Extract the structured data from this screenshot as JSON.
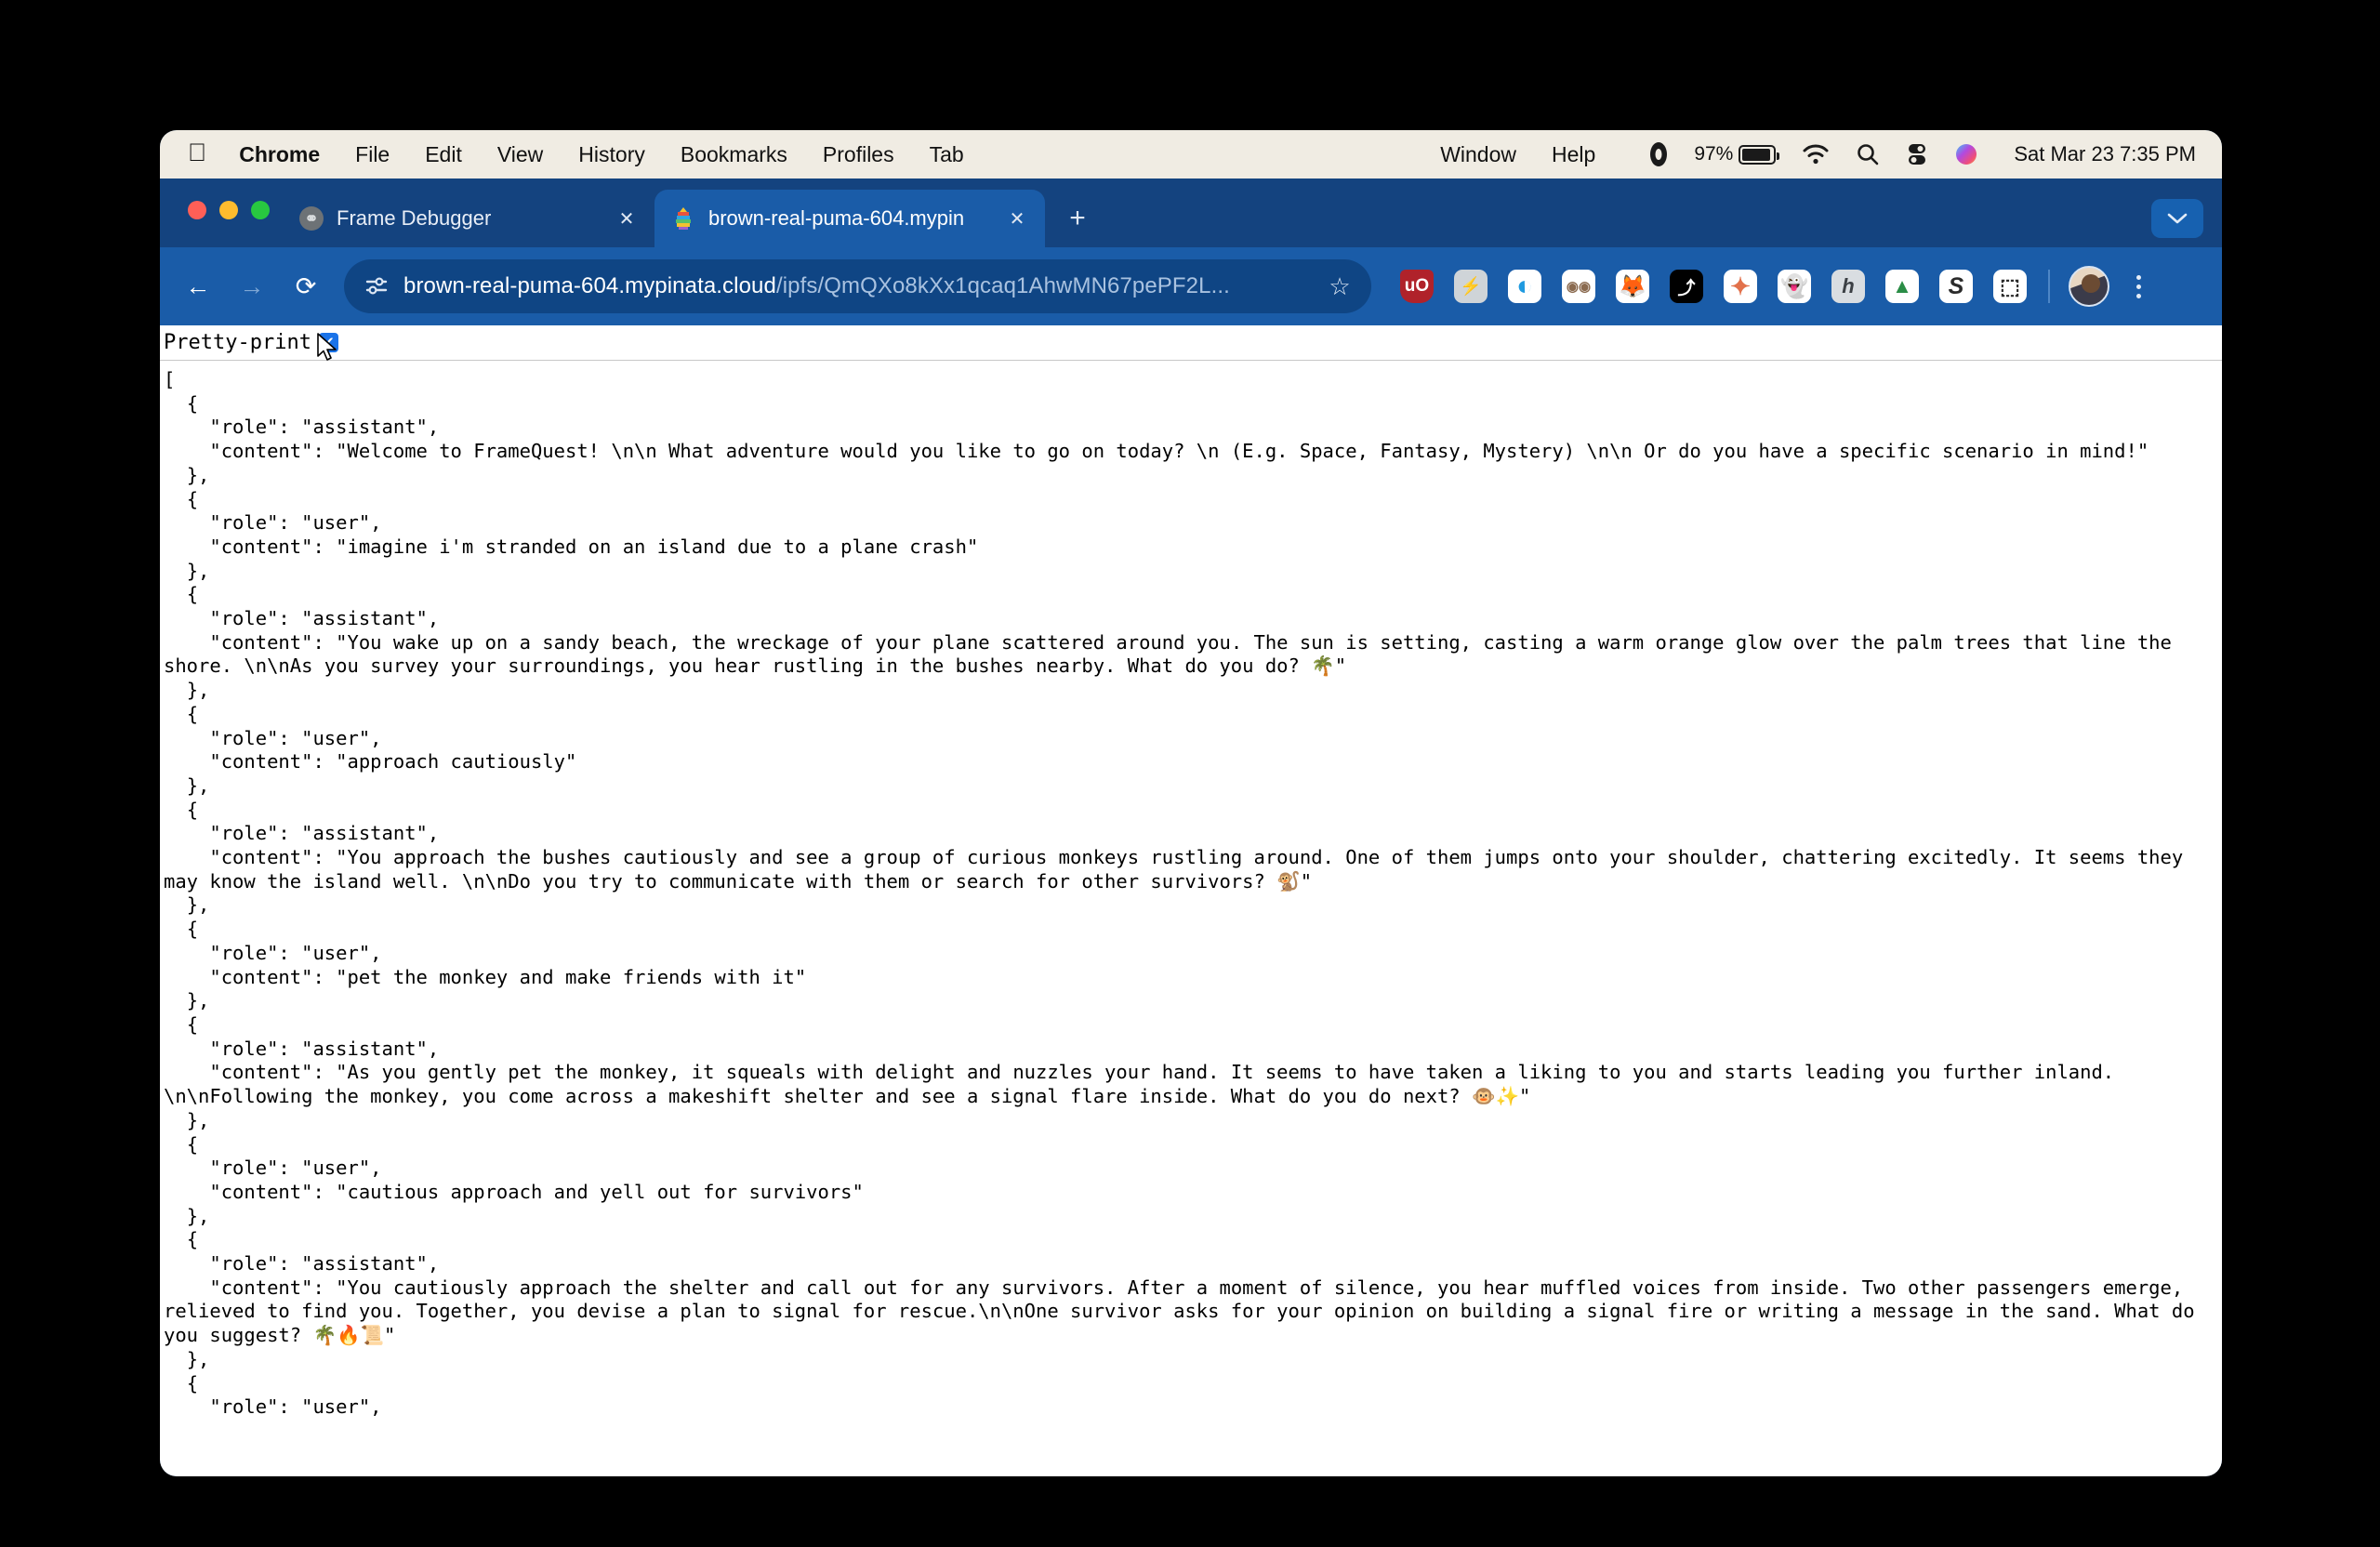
{
  "menubar": {
    "apple_icon": "apple-logo",
    "items": [
      "Chrome",
      "File",
      "Edit",
      "View",
      "History",
      "Bookmarks",
      "Profiles",
      "Tab"
    ],
    "right_items": [
      "Window",
      "Help"
    ],
    "status": {
      "recording_icon": "record-indicator-icon",
      "battery_percent": "97%",
      "battery_icon": "battery-icon",
      "wifi_icon": "wifi-icon",
      "search_icon": "spotlight-search-icon",
      "control_center_icon": "control-center-icon",
      "siri_icon": "siri-icon",
      "clock": "Sat Mar 23  7:35 PM"
    }
  },
  "tabs": [
    {
      "title": "Frame Debugger",
      "favicon": "frame-debugger-favicon",
      "active": false,
      "close": "✕"
    },
    {
      "title": "brown-real-puma-604.mypin",
      "favicon": "pinata-favicon",
      "active": true,
      "close": "✕"
    }
  ],
  "tabstrip": {
    "new_tab_label": "+",
    "tab_list_chevron": "⌄"
  },
  "toolbar": {
    "back_label": "←",
    "forward_label": "→",
    "reload_label": "⟳",
    "site_info_icon": "site-settings-icon",
    "url_domain": "brown-real-puma-604.mypinata.cloud",
    "url_path": "/ipfs/QmQXo8kXx1qcaq1AhwMN67pePF2L...",
    "bookmark_label": "☆",
    "extensions": [
      {
        "name": "ublock-origin-extension",
        "glyph": "uO",
        "bg": "#b0222a",
        "fg": "#ffffff"
      },
      {
        "name": "lightning-extension",
        "glyph": "⚡",
        "bg": "#cfd4d8",
        "fg": "#4a4f55"
      },
      {
        "name": "swirl-extension",
        "glyph": "◐",
        "bg": "#ffffff",
        "fg": "#1f9ae0"
      },
      {
        "name": "owl-extension",
        "glyph": "◉◉",
        "bg": "#ffffff",
        "fg": "#8a6a4f"
      },
      {
        "name": "fox-extension",
        "glyph": "🦊",
        "bg": "#ffffff",
        "fg": "#e06227"
      },
      {
        "name": "black-square-extension",
        "glyph": "⤴",
        "bg": "#000000",
        "fg": "#ffffff"
      },
      {
        "name": "claude-extension",
        "glyph": "✦",
        "bg": "#ffffff",
        "fg": "#e2714b"
      },
      {
        "name": "ghost-extension",
        "glyph": "👻",
        "bg": "#ffffff",
        "fg": "#a48ae8"
      },
      {
        "name": "honey-extension",
        "glyph": "h",
        "bg": "#d9dde1",
        "fg": "#3b3f44"
      },
      {
        "name": "google-drive-extension",
        "glyph": "▲",
        "bg": "#ffffff",
        "fg": "#2a8d46"
      },
      {
        "name": "s-circle-extension",
        "glyph": "S",
        "bg": "#ffffff",
        "fg": "#2b2b2b"
      },
      {
        "name": "extensions-puzzle-icon",
        "glyph": "⬚",
        "bg": "#ffffff",
        "fg": "#2b2b2b"
      }
    ],
    "profile_avatar": "profile-avatar",
    "menu_label": "chrome-menu-icon"
  },
  "page": {
    "pretty_print_label": "Pretty-print",
    "pretty_print_checked": true,
    "check_glyph": "✔",
    "json_text": "[\n  {\n    \"role\": \"assistant\",\n    \"content\": \"Welcome to FrameQuest! \\n\\n What adventure would you like to go on today? \\n (E.g. Space, Fantasy, Mystery) \\n\\n Or do you have a specific scenario in mind!\"\n  },\n  {\n    \"role\": \"user\",\n    \"content\": \"imagine i'm stranded on an island due to a plane crash\"\n  },\n  {\n    \"role\": \"assistant\",\n    \"content\": \"You wake up on a sandy beach, the wreckage of your plane scattered around you. The sun is setting, casting a warm orange glow over the palm trees that line the shore. \\n\\nAs you survey your surroundings, you hear rustling in the bushes nearby. What do you do? 🌴\"\n  },\n  {\n    \"role\": \"user\",\n    \"content\": \"approach cautiously\"\n  },\n  {\n    \"role\": \"assistant\",\n    \"content\": \"You approach the bushes cautiously and see a group of curious monkeys rustling around. One of them jumps onto your shoulder, chattering excitedly. It seems they may know the island well. \\n\\nDo you try to communicate with them or search for other survivors? 🐒\"\n  },\n  {\n    \"role\": \"user\",\n    \"content\": \"pet the monkey and make friends with it\"\n  },\n  {\n    \"role\": \"assistant\",\n    \"content\": \"As you gently pet the monkey, it squeals with delight and nuzzles your hand. It seems to have taken a liking to you and starts leading you further inland. \\n\\nFollowing the monkey, you come across a makeshift shelter and see a signal flare inside. What do you do next? 🐵✨\"\n  },\n  {\n    \"role\": \"user\",\n    \"content\": \"cautious approach and yell out for survivors\"\n  },\n  {\n    \"role\": \"assistant\",\n    \"content\": \"You cautiously approach the shelter and call out for any survivors. After a moment of silence, you hear muffled voices from inside. Two other passengers emerge, relieved to find you. Together, you devise a plan to signal for rescue.\\n\\nOne survivor asks for your opinion on building a signal fire or writing a message in the sand. What do you suggest? 🌴🔥📜\"\n  },\n  {\n    \"role\": \"user\","
  }
}
